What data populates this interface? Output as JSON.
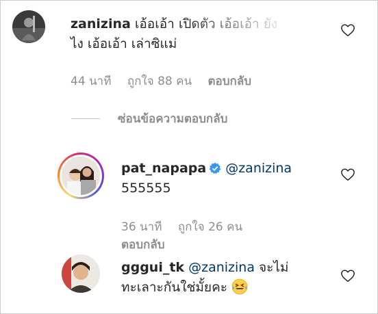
{
  "comments": [
    {
      "username": "zanizina",
      "text_line1": "เอ้อเอ้า เปิดตัว เอ้อเอ้า ยัง",
      "text_line2": "ไง เอ้อเอ้า เล่าซิแม่",
      "time": "44 นาที",
      "likes": "ถูกใจ 88 คน",
      "reply": "ตอบกลับ"
    },
    {
      "username": "pat_napapa",
      "mention": "@zanizina",
      "text": "555555",
      "time": "36 นาที",
      "likes": "ถูกใจ 26 คน",
      "reply": "ตอบกลับ"
    },
    {
      "username": "gggui_tk",
      "mention": "@zanizina",
      "text_line1_suffix": "จะไม่",
      "text_line2": "ทะเลาะกันใช่มั้ยคะ",
      "emoji": "grinning-squinting-tears-emoji"
    }
  ],
  "hide_replies_label": "ซ่อนข้อความตอบกลับ",
  "icons": {
    "like": "heart-outline-icon",
    "verified": "verified-badge-icon"
  },
  "colors": {
    "text": "#262626",
    "muted": "#8e8e8e",
    "mention": "#00376b",
    "verified": "#3897f0"
  }
}
